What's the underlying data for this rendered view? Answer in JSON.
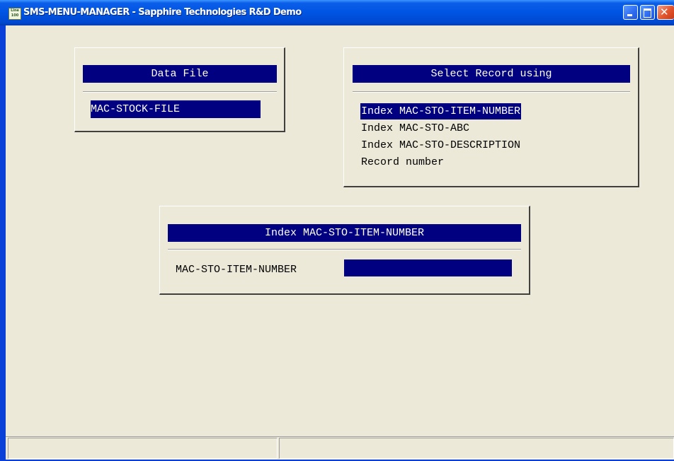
{
  "window": {
    "title": "SMS-MENU-MANAGER - Sapphire Technologies R&D Demo",
    "app_icon_top": "Line",
    "app_icon_bottom": "100",
    "close_glyph": "✕"
  },
  "data_file_panel": {
    "header": "Data File",
    "file_name": "MAC-STOCK-FILE"
  },
  "select_record_panel": {
    "header": "Select Record using",
    "options": [
      {
        "label": "Index MAC-STO-ITEM-NUMBER",
        "selected": true
      },
      {
        "label": "Index MAC-STO-ABC",
        "selected": false
      },
      {
        "label": "Index MAC-STO-DESCRIPTION",
        "selected": false
      },
      {
        "label": "Record number",
        "selected": false
      }
    ]
  },
  "index_panel": {
    "header": "Index MAC-STO-ITEM-NUMBER",
    "field_label": "MAC-STO-ITEM-NUMBER",
    "field_value": ""
  },
  "status_bar": {
    "pane1": "",
    "pane2": ""
  },
  "colors": {
    "highlight": "#000080",
    "background": "#ece9d8",
    "titlebar": "#0054e3"
  }
}
